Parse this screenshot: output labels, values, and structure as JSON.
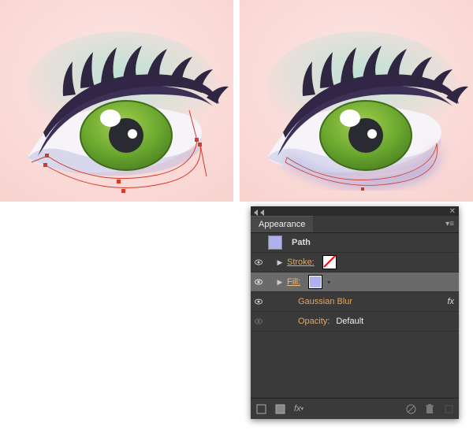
{
  "panel": {
    "title": "Appearance",
    "item_type": "Path",
    "rows": {
      "stroke_label": "Stroke:",
      "fill_label": "Fill:",
      "gaussian": "Gaussian Blur",
      "opacity_label": "Opacity:",
      "opacity_value": "Default"
    },
    "fx_badge": "fx",
    "colors": {
      "fill": "#aeb1ec",
      "path_thumb": "#aeb1ec"
    },
    "footer": {
      "new_art": "new-art",
      "duplicate": "duplicate",
      "fx": "fx",
      "clear": "clear",
      "delete": "delete"
    }
  },
  "artwork": {
    "show_path_left": true,
    "show_path_right": true
  }
}
